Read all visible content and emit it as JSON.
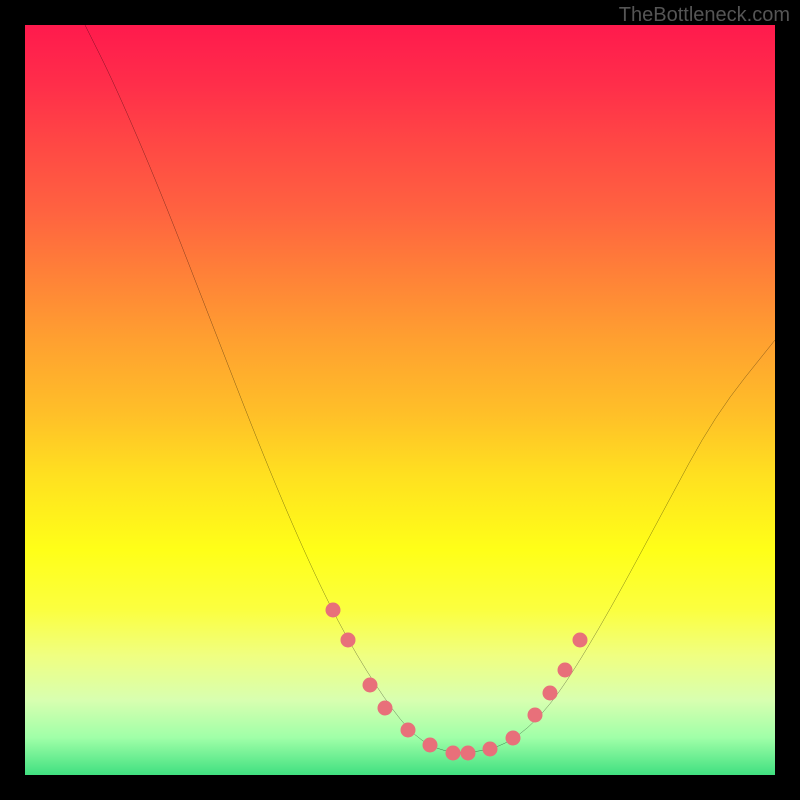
{
  "watermark": "TheBottleneck.com",
  "chart_data": {
    "type": "line",
    "title": "",
    "xlabel": "",
    "ylabel": "",
    "xlim": [
      0,
      100
    ],
    "ylim": [
      0,
      100
    ],
    "series": [
      {
        "name": "curve",
        "type": "line",
        "points": [
          {
            "x": 8,
            "y": 100
          },
          {
            "x": 12,
            "y": 92
          },
          {
            "x": 18,
            "y": 78
          },
          {
            "x": 25,
            "y": 60
          },
          {
            "x": 32,
            "y": 42
          },
          {
            "x": 38,
            "y": 28
          },
          {
            "x": 43,
            "y": 18
          },
          {
            "x": 48,
            "y": 10
          },
          {
            "x": 52,
            "y": 5
          },
          {
            "x": 56,
            "y": 3
          },
          {
            "x": 60,
            "y": 3
          },
          {
            "x": 64,
            "y": 4
          },
          {
            "x": 68,
            "y": 7
          },
          {
            "x": 72,
            "y": 12
          },
          {
            "x": 78,
            "y": 22
          },
          {
            "x": 85,
            "y": 35
          },
          {
            "x": 92,
            "y": 48
          },
          {
            "x": 100,
            "y": 58
          }
        ]
      },
      {
        "name": "dots",
        "type": "scatter",
        "points": [
          {
            "x": 41,
            "y": 22
          },
          {
            "x": 43,
            "y": 18
          },
          {
            "x": 46,
            "y": 12
          },
          {
            "x": 48,
            "y": 9
          },
          {
            "x": 51,
            "y": 6
          },
          {
            "x": 54,
            "y": 4
          },
          {
            "x": 57,
            "y": 3
          },
          {
            "x": 59,
            "y": 3
          },
          {
            "x": 62,
            "y": 3.5
          },
          {
            "x": 65,
            "y": 5
          },
          {
            "x": 68,
            "y": 8
          },
          {
            "x": 70,
            "y": 11
          },
          {
            "x": 72,
            "y": 14
          },
          {
            "x": 74,
            "y": 18
          }
        ]
      }
    ]
  }
}
